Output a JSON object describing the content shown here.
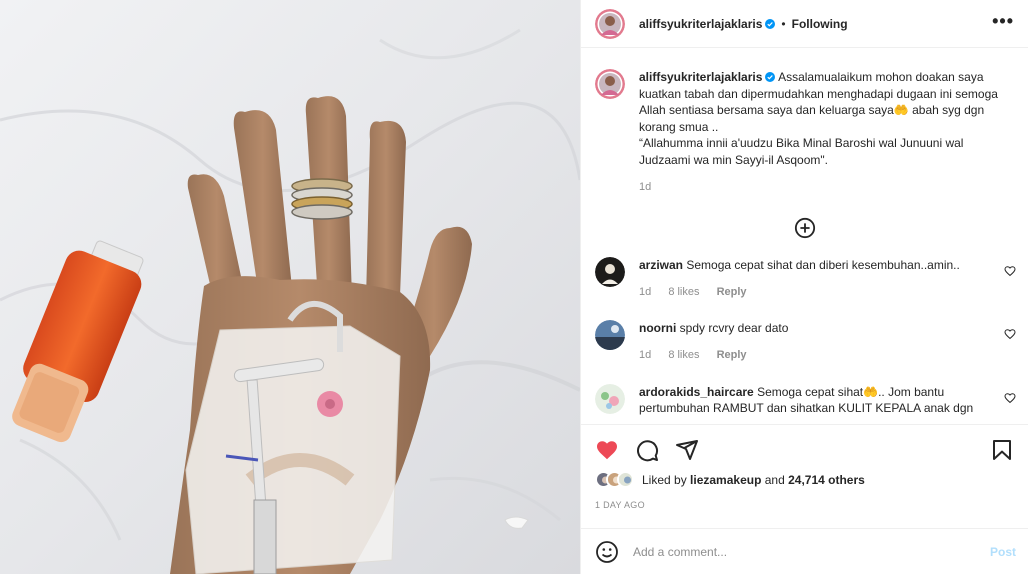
{
  "post": {
    "author": "aliffsyukriterlajaklaris",
    "separator": "•",
    "follow_status": "Following",
    "more_label": "•••"
  },
  "caption": {
    "username": "aliffsyukriterlajaklaris",
    "text": " Assalamualaikum mohon doakan saya kuatkan tabah dan dipermudahkan menghadapi dugaan ini semoga Allah sentiasa bersama saya dan keluarga saya🤲 abah syg dgn korang smua ..",
    "quote": "“Allahumma innii a'uudzu Bika Minal Baroshi wal Junuuni wal Judzaami wa min Sayyi-il Asqoom\".",
    "time": "1d"
  },
  "comments": [
    {
      "username": "arziwan",
      "text": " Semoga cepat sihat dan diberi kesembuhan..amin..",
      "time": "1d",
      "likes": "8 likes",
      "reply": "Reply"
    },
    {
      "username": "noorni",
      "text": " spdy rcvry dear dato",
      "time": "1d",
      "likes": "8 likes",
      "reply": "Reply"
    },
    {
      "username": "ardorakids_haircare",
      "text": " Semoga cepat sihat🤲.. Jom bantu pertumbuhan RAMBUT dan sihatkan KULIT KEPALA anak dgn",
      "time": "",
      "likes": "",
      "reply": ""
    }
  ],
  "likes": {
    "prefix": "Liked by ",
    "first_user": "liezamakeup",
    "middle": " and ",
    "others": "24,714 others"
  },
  "time_ago": "1 DAY AGO",
  "comment_box": {
    "placeholder": "Add a comment...",
    "post_label": "Post"
  },
  "colors": {
    "like_red": "#ed4956",
    "verified_blue": "#0095f6",
    "post_disabled": "#b2dffc",
    "secondary_text": "#8e8e8e"
  },
  "icons": [
    "heart-icon",
    "comment-icon",
    "share-icon",
    "bookmark-icon",
    "emoji-icon",
    "plus-circle-icon",
    "verified-icon"
  ]
}
